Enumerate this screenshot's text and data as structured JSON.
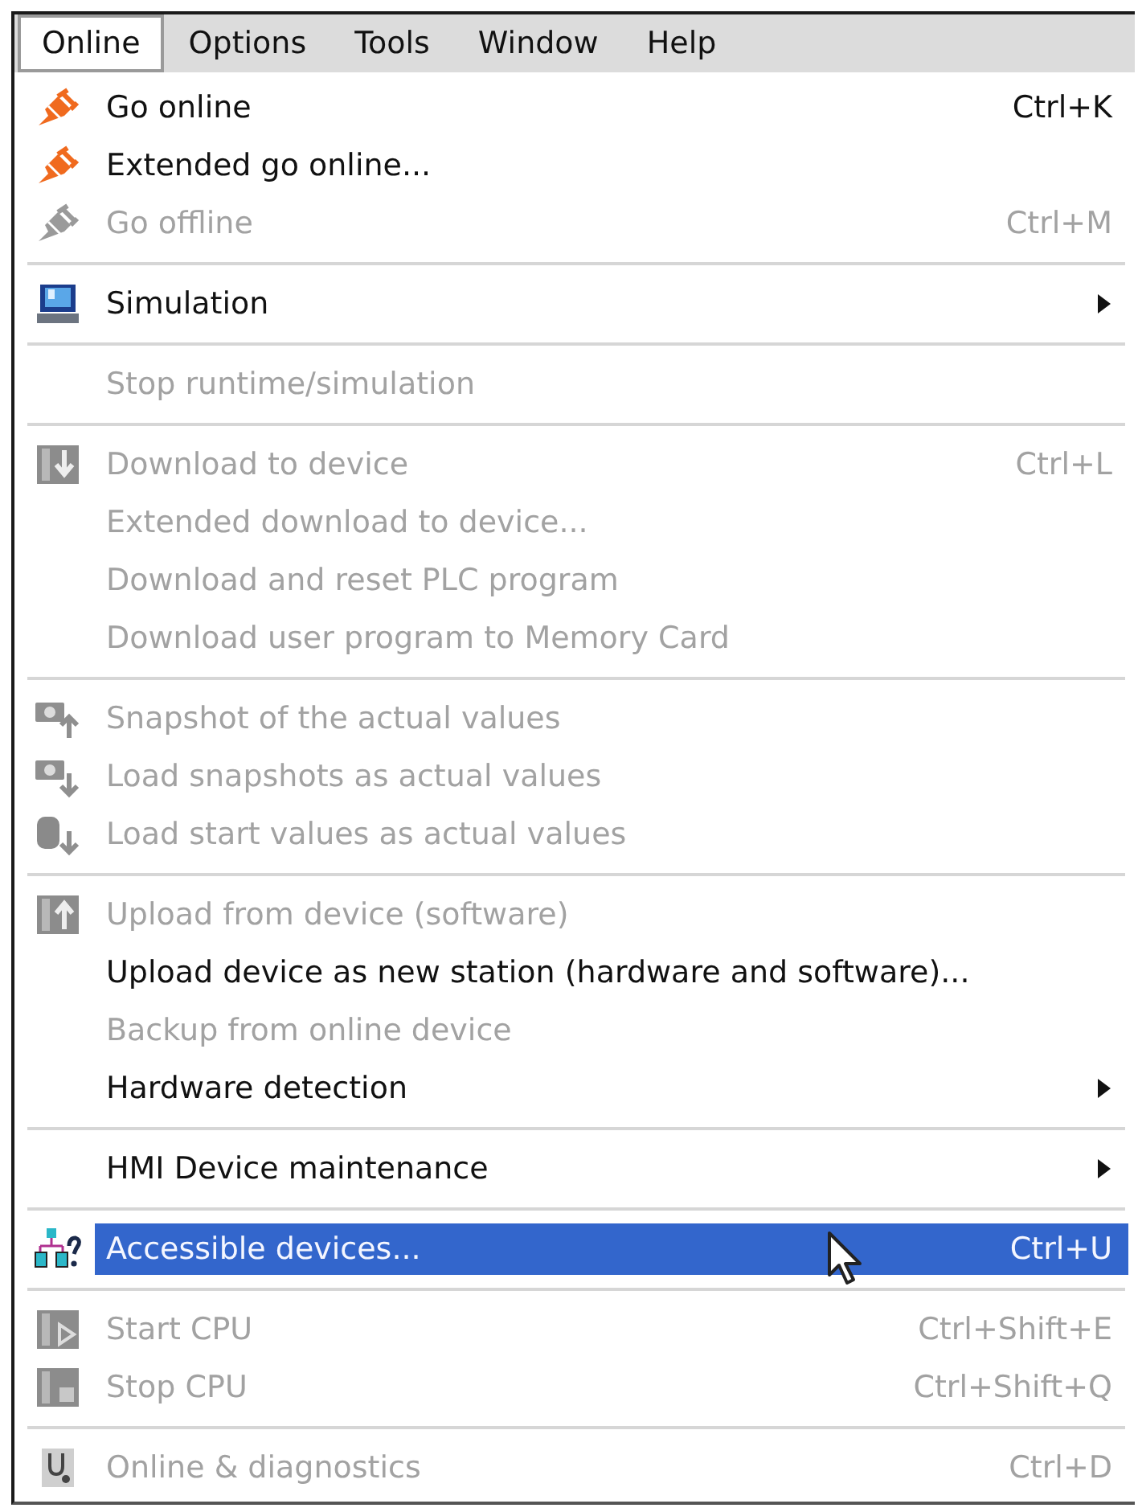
{
  "menu_bar": [
    {
      "label": "Online",
      "selected": true
    },
    {
      "label": "Options",
      "selected": false
    },
    {
      "label": "Tools",
      "selected": false
    },
    {
      "label": "Window",
      "selected": false
    },
    {
      "label": "Help",
      "selected": false
    }
  ],
  "menu_groups": [
    {
      "items": [
        {
          "kind": "command",
          "label": "Go online",
          "shortcut": "Ctrl+K",
          "disabled": false,
          "selected": false
        },
        {
          "kind": "command",
          "label": "Extended go online...",
          "disabled": false,
          "selected": false
        },
        {
          "kind": "command",
          "label": "Go offline",
          "shortcut": "Ctrl+M",
          "disabled": true,
          "selected": false
        }
      ]
    },
    {
      "items": [
        {
          "kind": "submenu",
          "label": "Simulation",
          "disabled": false,
          "selected": false
        }
      ]
    },
    {
      "items": [
        {
          "kind": "command",
          "label": "Stop runtime/simulation",
          "disabled": true,
          "selected": false
        }
      ]
    },
    {
      "items": [
        {
          "kind": "command",
          "label": "Download to device",
          "shortcut": "Ctrl+L",
          "disabled": true,
          "selected": false
        },
        {
          "kind": "command",
          "label": "Extended download to device...",
          "disabled": true,
          "selected": false
        },
        {
          "kind": "command",
          "label": "Download and reset PLC program",
          "disabled": true,
          "selected": false
        },
        {
          "kind": "command",
          "label": "Download user program to Memory Card",
          "disabled": true,
          "selected": false
        }
      ]
    },
    {
      "items": [
        {
          "kind": "command",
          "label": "Snapshot of the actual values",
          "disabled": true,
          "selected": false
        },
        {
          "kind": "command",
          "label": "Load snapshots as actual values",
          "disabled": true,
          "selected": false
        },
        {
          "kind": "command",
          "label": "Load start values as actual values",
          "disabled": true,
          "selected": false
        }
      ]
    },
    {
      "items": [
        {
          "kind": "command",
          "label": "Upload from device (software)",
          "disabled": true,
          "selected": false
        },
        {
          "kind": "command",
          "label": "Upload device as new station (hardware and software)...",
          "disabled": false,
          "selected": false
        },
        {
          "kind": "command",
          "label": "Backup from online device",
          "disabled": true,
          "selected": false
        },
        {
          "kind": "submenu",
          "label": "Hardware detection",
          "disabled": false,
          "selected": false
        }
      ]
    },
    {
      "items": [
        {
          "kind": "submenu",
          "label": "HMI Device maintenance",
          "disabled": false,
          "selected": false
        }
      ]
    },
    {
      "items": [
        {
          "kind": "command",
          "label": "Accessible devices...",
          "shortcut": "Ctrl+U",
          "disabled": false,
          "selected": true
        }
      ]
    },
    {
      "items": [
        {
          "kind": "command",
          "label": "Start CPU",
          "shortcut": "Ctrl+Shift+E",
          "disabled": true,
          "selected": false
        },
        {
          "kind": "command",
          "label": "Stop CPU",
          "shortcut": "Ctrl+Shift+Q",
          "disabled": true,
          "selected": false
        }
      ]
    },
    {
      "items": [
        {
          "kind": "command",
          "label": "Online & diagnostics",
          "shortcut": "Ctrl+D",
          "disabled": true,
          "selected": false
        }
      ]
    }
  ]
}
